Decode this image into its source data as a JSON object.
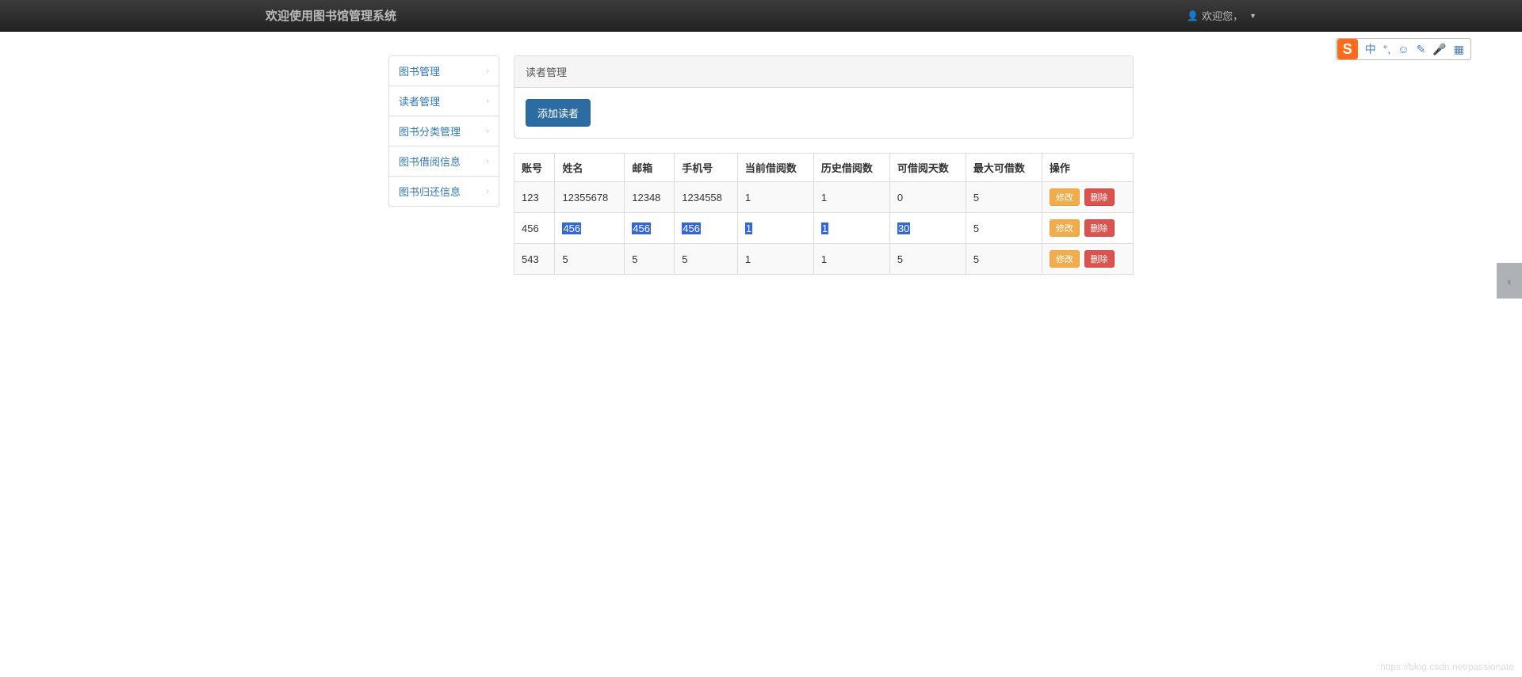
{
  "navbar": {
    "title": "欢迎使用图书馆管理系统",
    "welcome": "欢迎您，"
  },
  "sidebar": {
    "items": [
      {
        "label": "图书管理"
      },
      {
        "label": "读者管理"
      },
      {
        "label": "图书分类管理"
      },
      {
        "label": "图书借阅信息"
      },
      {
        "label": "图书归还信息"
      }
    ]
  },
  "panel": {
    "heading": "读者管理",
    "add_button": "添加读者"
  },
  "table": {
    "headers": {
      "account": "账号",
      "name": "姓名",
      "email": "邮箱",
      "phone": "手机号",
      "current_borrow": "当前借阅数",
      "history_borrow": "历史借阅数",
      "borrow_days": "可借阅天数",
      "max_borrow": "最大可借数",
      "ops": "操作"
    },
    "rows": [
      {
        "account": "123",
        "name": "12355678",
        "email": "12348",
        "phone": "1234558",
        "current": "1",
        "history": "1",
        "days": "0",
        "max": "5",
        "highlight": false
      },
      {
        "account": "456",
        "name": "456",
        "email": "456",
        "phone": "456",
        "current": "1",
        "history": "1",
        "days": "30",
        "max": "5",
        "highlight": true
      },
      {
        "account": "543",
        "name": "5",
        "email": "5",
        "phone": "5",
        "current": "1",
        "history": "1",
        "days": "5",
        "max": "5",
        "highlight": false
      }
    ],
    "btn_edit": "修改",
    "btn_delete": "删除"
  },
  "ime": {
    "logo": "S",
    "lang": "中"
  },
  "watermark": "https://blog.csdn.net/passionate"
}
